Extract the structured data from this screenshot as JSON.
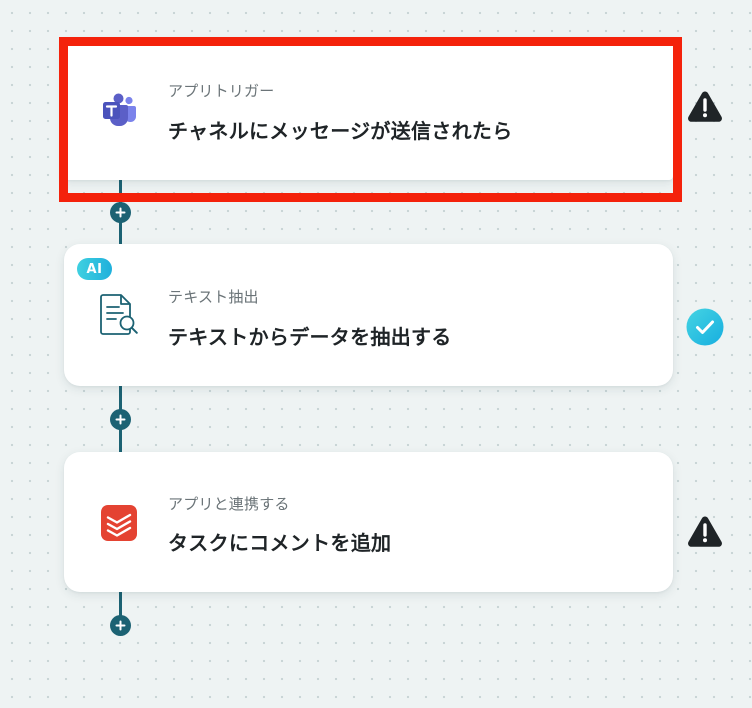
{
  "flow": {
    "steps": [
      {
        "subtitle": "アプリトリガー",
        "title": "チャネルにメッセージが送信されたら",
        "icon": "teams-icon",
        "status": "warning",
        "selected": true
      },
      {
        "subtitle": "テキスト抽出",
        "title": "テキストからデータを抽出する",
        "icon": "document-search-icon",
        "badge": "AI",
        "status": "completed"
      },
      {
        "subtitle": "アプリと連携する",
        "title": "タスクにコメントを追加",
        "icon": "todoist-icon",
        "status": "warning"
      }
    ]
  },
  "colors": {
    "connector": "#1c6273",
    "selection_border": "#f4220b",
    "warning": "#1f2427",
    "success": "#22c3da",
    "ai_badge": "#2bc0de",
    "teams": "#5b5fc7",
    "todoist": "#e44332"
  }
}
